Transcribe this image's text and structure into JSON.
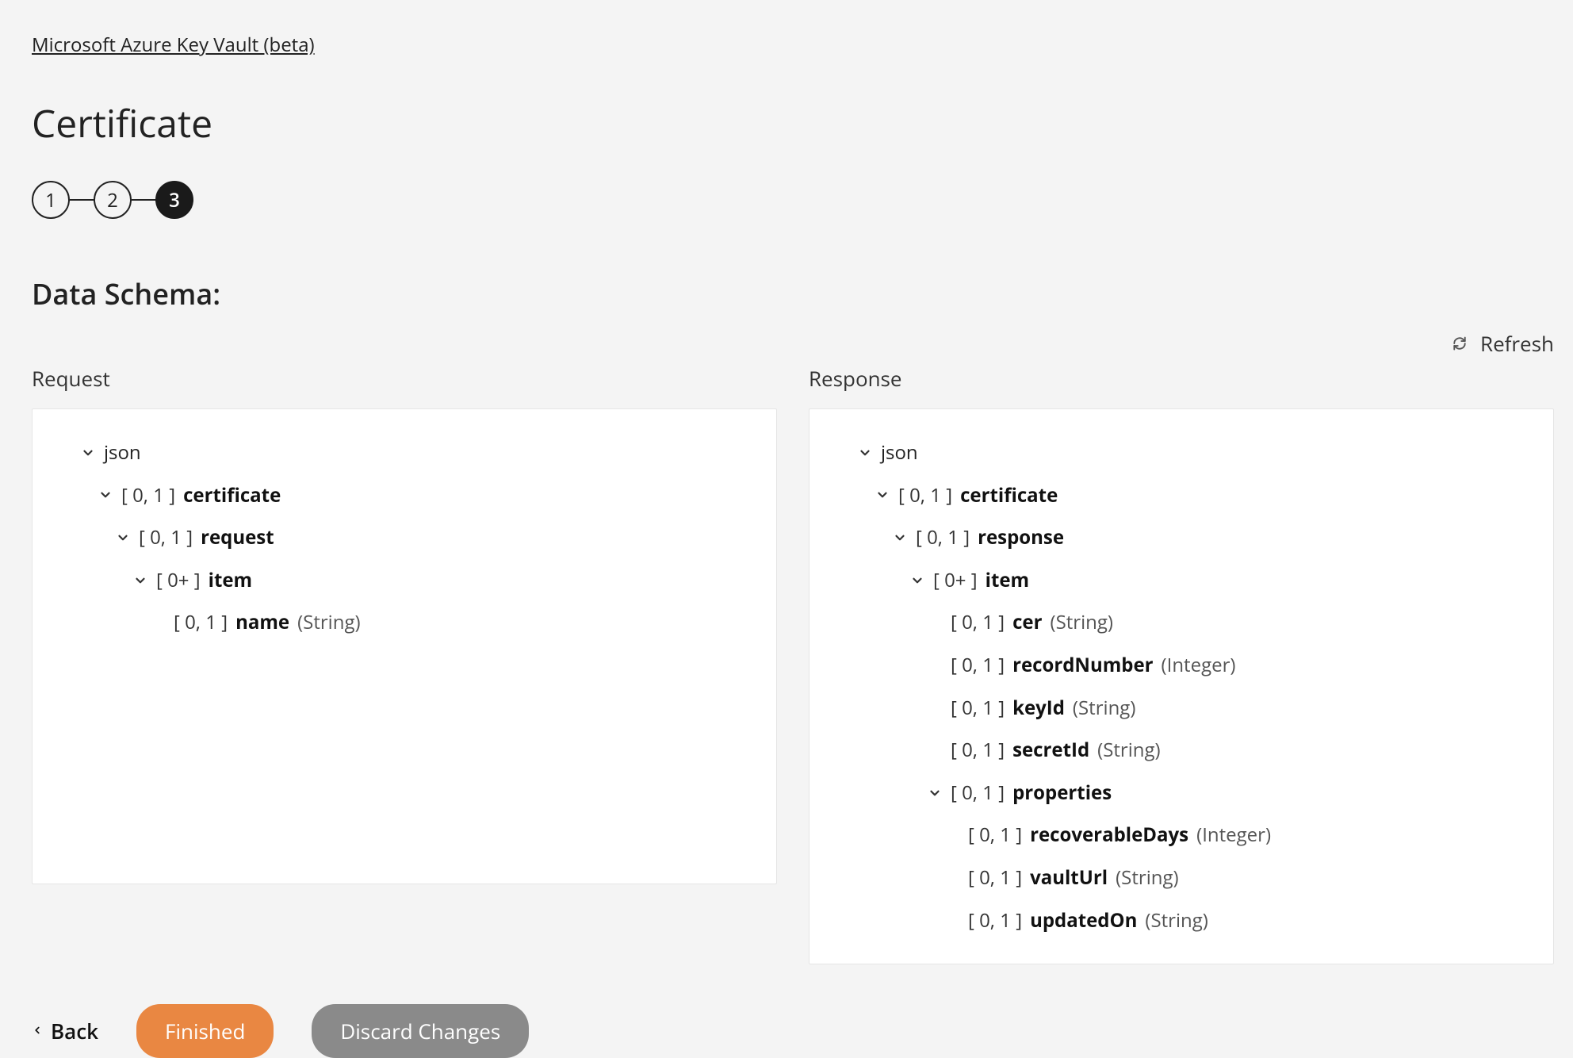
{
  "breadcrumb": {
    "text": "Microsoft Azure Key Vault (beta)"
  },
  "page": {
    "title": "Certificate"
  },
  "stepper": {
    "steps": [
      "1",
      "2",
      "3"
    ],
    "active_index": 2
  },
  "section": {
    "title": "Data Schema:"
  },
  "toolbar": {
    "refresh": "Refresh"
  },
  "columns": {
    "request": "Request",
    "response": "Response"
  },
  "tree": {
    "root": "json",
    "occ": {
      "opt": "[ 0, 1 ]",
      "many": "[ 0+ ]"
    },
    "types": {
      "string": "(String)",
      "integer": "(Integer)"
    },
    "request": {
      "certificate": "certificate",
      "request": "request",
      "item": "item",
      "name": "name"
    },
    "response": {
      "certificate": "certificate",
      "response": "response",
      "item": "item",
      "cer": "cer",
      "recordNumber": "recordNumber",
      "keyId": "keyId",
      "secretId": "secretId",
      "properties": "properties",
      "recoverableDays": "recoverableDays",
      "vaultUrl": "vaultUrl",
      "updatedOn": "updatedOn"
    }
  },
  "footer": {
    "back": "Back",
    "finished": "Finished",
    "discard": "Discard Changes"
  }
}
